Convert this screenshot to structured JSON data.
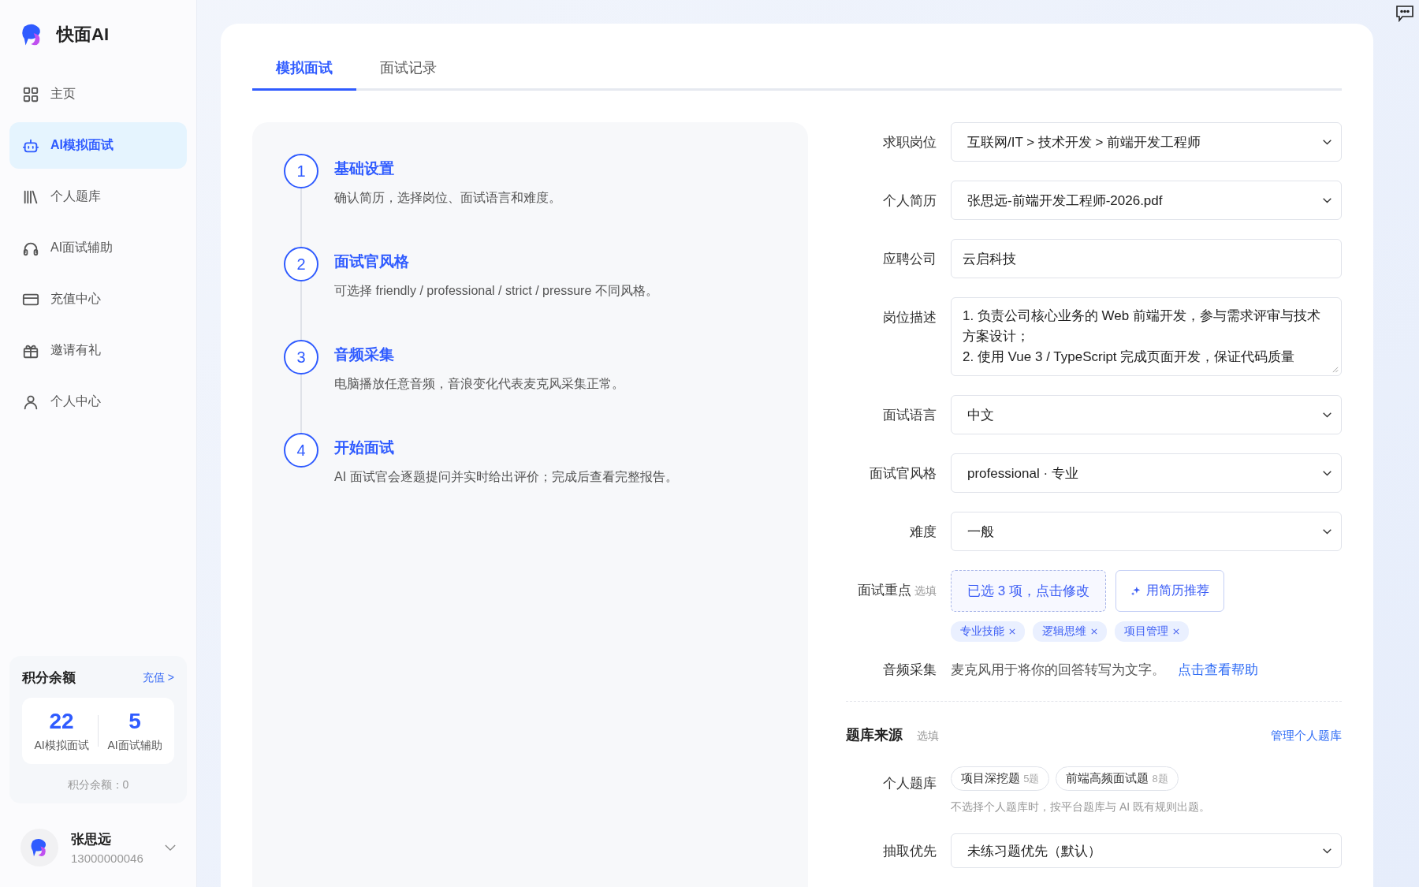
{
  "brand": {
    "name": "快面AI"
  },
  "nav": [
    {
      "label": "主页",
      "selected": false
    },
    {
      "label": "AI模拟面试",
      "selected": true
    },
    {
      "label": "个人题库",
      "selected": false
    },
    {
      "label": "AI面试辅助",
      "selected": false
    },
    {
      "label": "充值中心",
      "selected": false
    },
    {
      "label": "邀请有礼",
      "selected": false
    },
    {
      "label": "个人中心",
      "selected": false
    }
  ],
  "credits": {
    "title": "积分余额",
    "recharge": "充值 >",
    "counts": [
      {
        "value": "22",
        "label": "AI模拟面试"
      },
      {
        "value": "5",
        "label": "AI面试辅助"
      }
    ],
    "balance": "积分余额：0"
  },
  "user": {
    "name": "张思远",
    "phone": "13000000046"
  },
  "tabs": [
    {
      "label": "模拟面试",
      "selected": true
    },
    {
      "label": "面试记录",
      "selected": false
    }
  ],
  "steps": [
    {
      "number": "1",
      "title": "基础设置",
      "desc": "确认简历，选择岗位、面试语言和难度。"
    },
    {
      "number": "2",
      "title": "面试官风格",
      "desc": "可选择 friendly / professional / strict / pressure 不同风格。"
    },
    {
      "number": "3",
      "title": "音频采集",
      "desc": "电脑播放任意音频，音浪变化代表麦克风采集正常。"
    },
    {
      "number": "4",
      "title": "开始面试",
      "desc": "AI 面试官会逐题提问并实时给出评价；完成后查看完整报告。"
    }
  ],
  "form": [
    {
      "kind": "select",
      "label": "求职岗位",
      "value": "互联网/IT > 技术开发 > 前端开发工程师"
    },
    {
      "kind": "select",
      "label": "个人简历",
      "value": "张思远-前端开发工程师-2026.pdf"
    },
    {
      "kind": "input",
      "label": "应聘公司",
      "value": "云启科技"
    },
    {
      "kind": "textarea",
      "label": "岗位描述",
      "value": "1. 负责公司核心业务的 Web 前端开发，参与需求评审与技术方案设计；\n2. 使用 Vue 3 / TypeScript 完成页面开发，保证代码质量"
    },
    {
      "kind": "select",
      "label": "面试语言",
      "value": "中文"
    },
    {
      "kind": "select",
      "label": "面试官风格",
      "value": "professional · 专业"
    },
    {
      "kind": "select",
      "label": "难度",
      "value": "一般"
    }
  ],
  "focus": {
    "label": "面试重点",
    "optional": "选填",
    "picker": "已选 3 项，点击修改",
    "recommend": "用简历推荐",
    "tags": [
      "专业技能",
      "逻辑思维",
      "项目管理"
    ]
  },
  "audio": {
    "label": "音频采集",
    "text": "麦克风用于将你的回答转写为文字。",
    "link": "点击查看帮助"
  },
  "bank": {
    "title": "题库来源",
    "optional": "选填",
    "manage": "管理个人题库",
    "label": "个人题库",
    "chips": [
      {
        "name": "项目深挖题",
        "count": "5题",
        "selected": false
      },
      {
        "name": "前端高频面试题",
        "count": "8题",
        "selected": false
      }
    ],
    "hint": "不选择个人题库时，按平台题库与 AI 既有规则出题。",
    "priority_label": "抽取优先",
    "priority_value": "未练习题优先（默认）"
  }
}
